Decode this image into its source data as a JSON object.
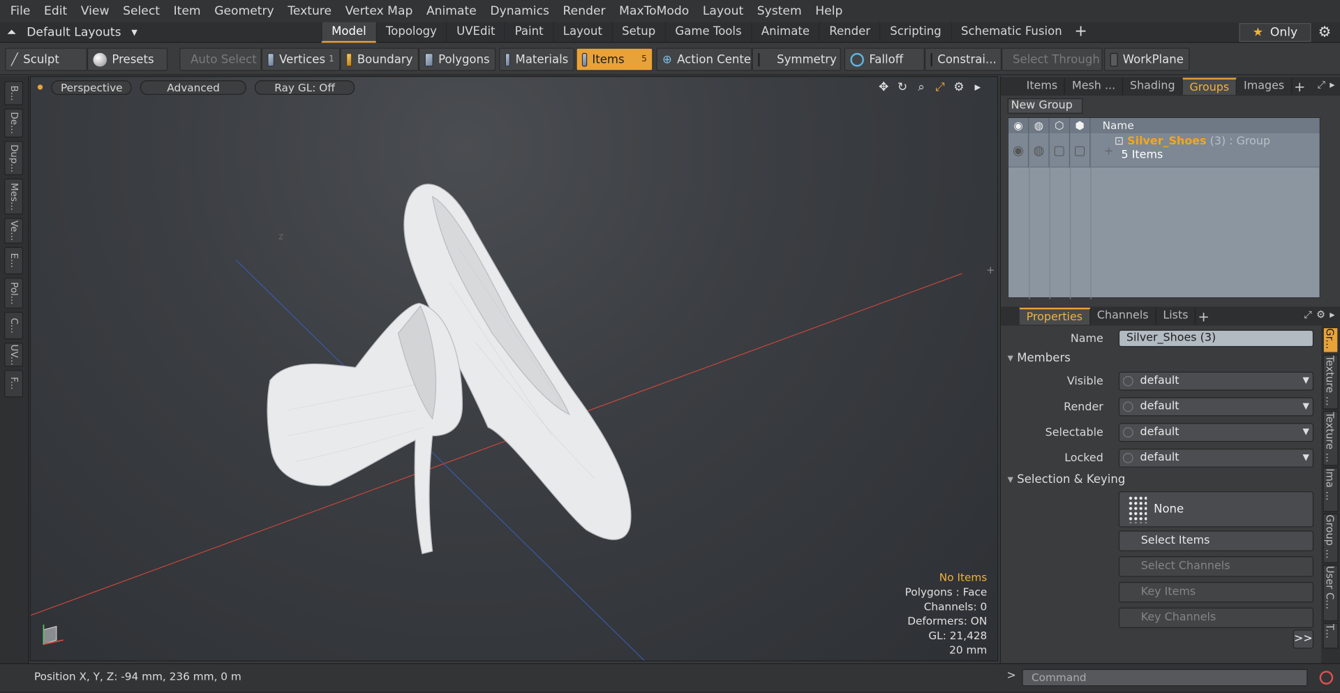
{
  "menu": [
    "File",
    "Edit",
    "View",
    "Select",
    "Item",
    "Geometry",
    "Texture",
    "Vertex Map",
    "Animate",
    "Dynamics",
    "Render",
    "MaxToModo",
    "Layout",
    "System",
    "Help"
  ],
  "layout_selector": "Default Layouts",
  "layout_tabs": [
    "Model",
    "Topology",
    "UVEdit",
    "Paint",
    "Layout",
    "Setup",
    "Game Tools",
    "Animate",
    "Render",
    "Scripting",
    "Schematic Fusion"
  ],
  "only_label": "Only",
  "toolbar": {
    "sculpt": "Sculpt",
    "presets": "Presets",
    "auto_select": "Auto Select",
    "vertices": "Vertices",
    "vertices_count": "1",
    "boundary": "Boundary",
    "polygons": "Polygons",
    "materials": "Materials",
    "items": "Items",
    "items_count": "5",
    "action_center": "Action Center",
    "symmetry": "Symmetry",
    "falloff": "Falloff",
    "constraints": "Constrai...",
    "select_through": "Select Through",
    "workplane": "WorkPlane"
  },
  "left_tabs": [
    "B...",
    "De...",
    "Dup...",
    "Mes...",
    "Ve...",
    "E...",
    "Pol...",
    "C...",
    "UV...",
    "F..."
  ],
  "viewport": {
    "perspective": "Perspective",
    "advanced": "Advanced",
    "raygl": "Ray GL: Off",
    "axis_z": "z"
  },
  "stats": {
    "no_items": "No Items",
    "polygons": "Polygons : Face",
    "channels": "Channels: 0",
    "deformers": "Deformers: ON",
    "gl": "GL: 21,428",
    "scale": "20 mm"
  },
  "status": {
    "position": "Position X, Y, Z:  -94 mm, 236 mm, 0 m"
  },
  "top_tabs": [
    "Items",
    "Mesh ...",
    "Shading",
    "Groups",
    "Images"
  ],
  "groups": {
    "new_group": "New Group",
    "col_name": "Name",
    "row": {
      "name": "Silver_Shoes",
      "suffix": " (3) : Group",
      "count": "5 Items",
      "expand": "+"
    }
  },
  "prop_tabs": [
    "Properties",
    "Channels",
    "Lists"
  ],
  "props": {
    "name_label": "Name",
    "name_value": "Silver_Shoes (3)",
    "members": "Members",
    "visible_label": "Visible",
    "visible_value": "default",
    "render_label": "Render",
    "render_value": "default",
    "selectable_label": "Selectable",
    "selectable_value": "default",
    "locked_label": "Locked",
    "locked_value": "default",
    "sel_keying": "Selection & Keying",
    "none": "None",
    "select_items": "Select Items",
    "select_channels": "Select Channels",
    "key_items": "Key Items",
    "key_channels": "Key Channels",
    "more": ">>"
  },
  "right_vtabs": [
    "Gr...",
    "Texture ...",
    "Texture ...",
    "Ima ...",
    "Group ...",
    "User C...",
    "T..."
  ],
  "command": {
    "caret": ">",
    "placeholder": "Command"
  },
  "colors": {
    "accent": "#e8a23a",
    "group_name": "#f7a51a"
  }
}
